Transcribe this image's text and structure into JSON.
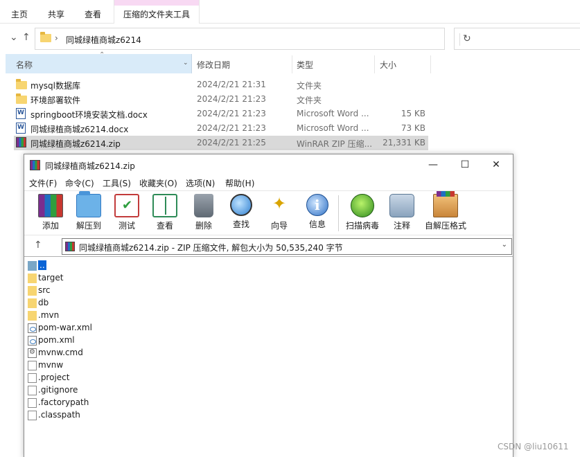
{
  "explorer": {
    "ribbon_tabs": [
      "主页",
      "共享",
      "查看"
    ],
    "context_tab": "压缩的文件夹工具",
    "address": "同城绿植商城z6214",
    "columns": {
      "name": "名称",
      "date": "修改日期",
      "type": "类型",
      "size": "大小"
    },
    "files": [
      {
        "name": "mysql数据库",
        "date": "2024/2/21 21:31",
        "type": "文件夹",
        "size": "",
        "icon": "folder-icon"
      },
      {
        "name": "环境部署软件",
        "date": "2024/2/21 21:23",
        "type": "文件夹",
        "size": "",
        "icon": "folder-icon"
      },
      {
        "name": "springboot环境安装文档.docx",
        "date": "2024/2/21 21:23",
        "type": "Microsoft Word ...",
        "size": "15 KB",
        "icon": "word-icon"
      },
      {
        "name": "同城绿植商城z6214.docx",
        "date": "2024/2/21 21:23",
        "type": "Microsoft Word ...",
        "size": "73 KB",
        "icon": "word-icon"
      },
      {
        "name": "同城绿植商城z6214.zip",
        "date": "2024/2/21 21:25",
        "type": "WinRAR ZIP 压缩...",
        "size": "21,331 KB",
        "icon": "winrar-icon",
        "selected": true
      }
    ]
  },
  "winrar": {
    "title": "同城绿植商城z6214.zip",
    "menu": [
      "文件(F)",
      "命令(C)",
      "工具(S)",
      "收藏夹(O)",
      "选项(N)",
      "帮助(H)"
    ],
    "tools": [
      "添加",
      "解压到",
      "测试",
      "查看",
      "删除",
      "查找",
      "向导",
      "信息",
      "扫描病毒",
      "注释",
      "自解压格式"
    ],
    "path": "同城绿植商城z6214.zip - ZIP 压缩文件, 解包大小为 50,535,240 字节",
    "items": [
      {
        "name": "..",
        "kind": "parent"
      },
      {
        "name": "target",
        "kind": "folder"
      },
      {
        "name": "src",
        "kind": "folder"
      },
      {
        "name": "db",
        "kind": "folder"
      },
      {
        "name": ".mvn",
        "kind": "folder"
      },
      {
        "name": "pom-war.xml",
        "kind": "xml"
      },
      {
        "name": "pom.xml",
        "kind": "xml"
      },
      {
        "name": "mvnw.cmd",
        "kind": "cmd"
      },
      {
        "name": "mvnw",
        "kind": "file"
      },
      {
        "name": ".project",
        "kind": "file"
      },
      {
        "name": ".gitignore",
        "kind": "file"
      },
      {
        "name": ".factorypath",
        "kind": "file"
      },
      {
        "name": ".classpath",
        "kind": "file"
      }
    ]
  },
  "watermark": "CSDN @liu10611",
  "colors": {
    "selection": "#d9d9d9",
    "header_active": "#d9ebf9",
    "context_tab": "#f8d9f3",
    "rar_selected": "#0a64d6"
  }
}
